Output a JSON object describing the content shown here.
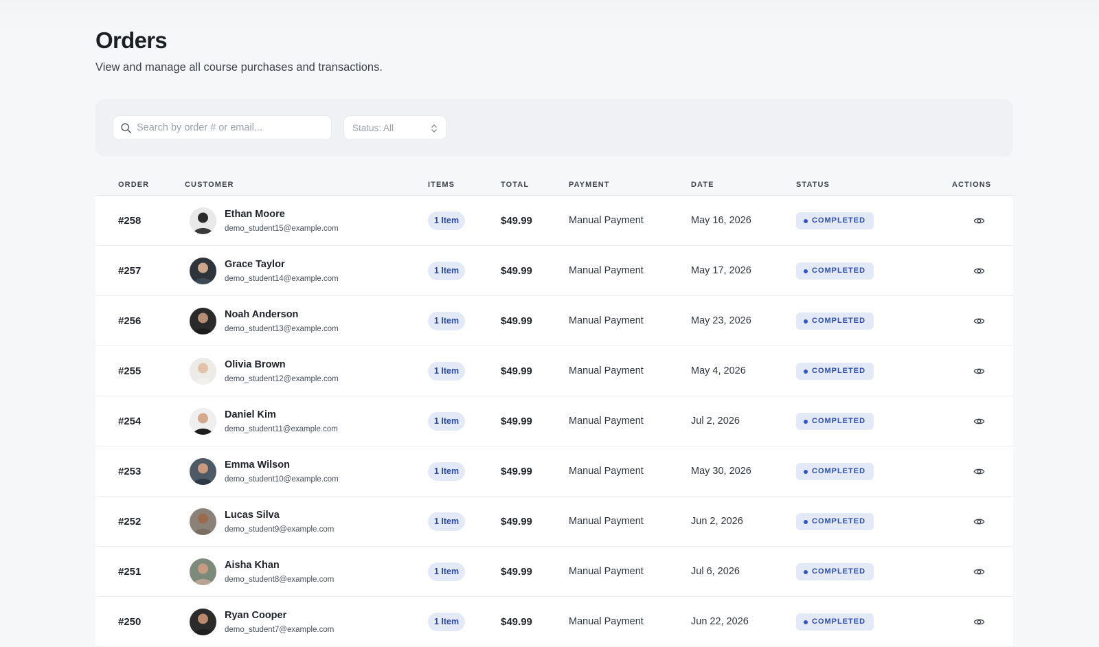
{
  "header": {
    "title": "Orders",
    "subtitle": "View and manage all course purchases and transactions."
  },
  "filters": {
    "search_placeholder": "Search by order # or email...",
    "status_value": "Status: All"
  },
  "colors": {
    "accent": "#2a4aa8",
    "badge_bg": "#e3e9f7",
    "page_bg": "#f6f7f9"
  },
  "table": {
    "columns": {
      "order": "ORDER",
      "customer": "CUSTOMER",
      "items": "ITEMS",
      "total": "TOTAL",
      "payment": "PAYMENT",
      "date": "DATE",
      "status": "STATUS",
      "actions": "ACTIONS"
    },
    "rows": [
      {
        "order": "#258",
        "name": "Ethan Moore",
        "email": "demo_student15@example.com",
        "items": "1 Item",
        "total": "$49.99",
        "payment": "Manual Payment",
        "date": "May 16, 2026",
        "status": "COMPLETED",
        "action_icon": "eye-icon"
      },
      {
        "order": "#257",
        "name": "Grace Taylor",
        "email": "demo_student14@example.com",
        "items": "1 Item",
        "total": "$49.99",
        "payment": "Manual Payment",
        "date": "May 17, 2026",
        "status": "COMPLETED",
        "action_icon": "eye-icon"
      },
      {
        "order": "#256",
        "name": "Noah Anderson",
        "email": "demo_student13@example.com",
        "items": "1 Item",
        "total": "$49.99",
        "payment": "Manual Payment",
        "date": "May 23, 2026",
        "status": "COMPLETED",
        "action_icon": "eye-icon"
      },
      {
        "order": "#255",
        "name": "Olivia Brown",
        "email": "demo_student12@example.com",
        "items": "1 Item",
        "total": "$49.99",
        "payment": "Manual Payment",
        "date": "May 4, 2026",
        "status": "COMPLETED",
        "action_icon": "eye-icon"
      },
      {
        "order": "#254",
        "name": "Daniel Kim",
        "email": "demo_student11@example.com",
        "items": "1 Item",
        "total": "$49.99",
        "payment": "Manual Payment",
        "date": "Jul 2, 2026",
        "status": "COMPLETED",
        "action_icon": "eye-icon"
      },
      {
        "order": "#253",
        "name": "Emma Wilson",
        "email": "demo_student10@example.com",
        "items": "1 Item",
        "total": "$49.99",
        "payment": "Manual Payment",
        "date": "May 30, 2026",
        "status": "COMPLETED",
        "action_icon": "eye-icon"
      },
      {
        "order": "#252",
        "name": "Lucas Silva",
        "email": "demo_student9@example.com",
        "items": "1 Item",
        "total": "$49.99",
        "payment": "Manual Payment",
        "date": "Jun 2, 2026",
        "status": "COMPLETED",
        "action_icon": "eye-icon"
      },
      {
        "order": "#251",
        "name": "Aisha Khan",
        "email": "demo_student8@example.com",
        "items": "1 Item",
        "total": "$49.99",
        "payment": "Manual Payment",
        "date": "Jul 6, 2026",
        "status": "COMPLETED",
        "action_icon": "eye-icon"
      },
      {
        "order": "#250",
        "name": "Ryan Cooper",
        "email": "demo_student7@example.com",
        "items": "1 Item",
        "total": "$49.99",
        "payment": "Manual Payment",
        "date": "Jun 22, 2026",
        "status": "COMPLETED",
        "action_icon": "eye-icon"
      }
    ]
  }
}
